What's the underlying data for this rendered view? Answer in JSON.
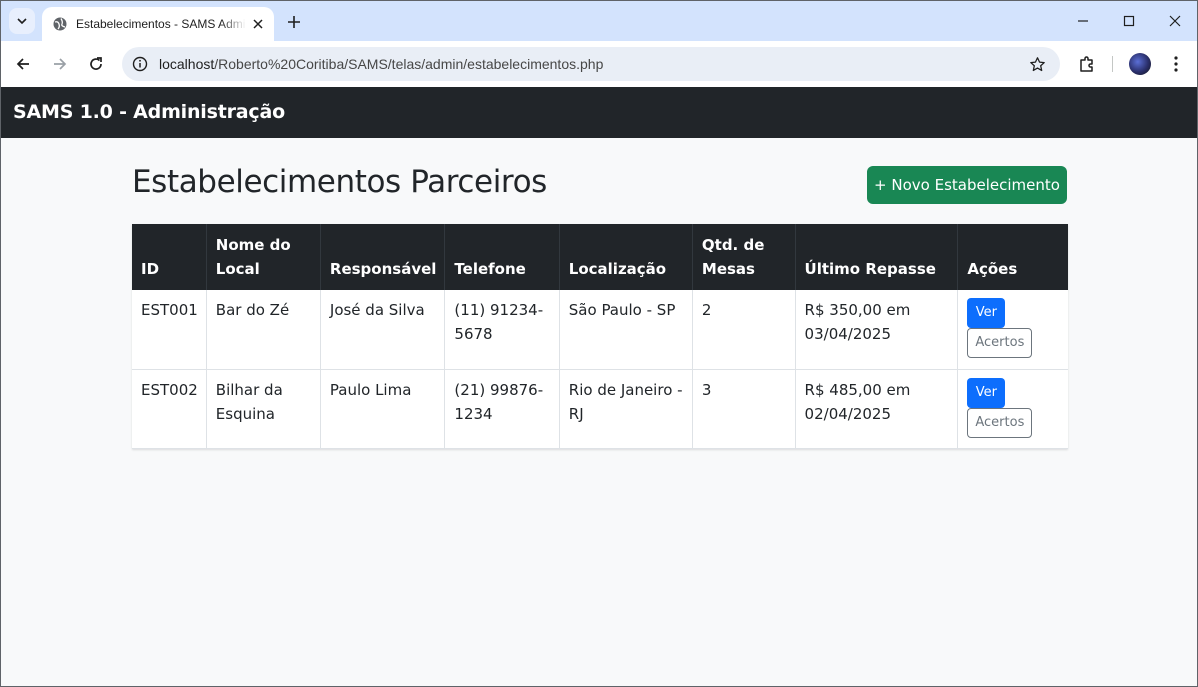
{
  "browser": {
    "tab_title": "Estabelecimentos - SAMS Admin",
    "url_host": "localhost",
    "url_path": "/Roberto%20Coritiba/SAMS/telas/admin/estabelecimentos.php"
  },
  "navbar": {
    "brand": "SAMS 1.0 - Administração"
  },
  "page": {
    "title": "Estabelecimentos Parceiros",
    "new_button": "+ Novo Estabelecimento"
  },
  "table": {
    "headers": [
      "ID",
      "Nome do Local",
      "Responsável",
      "Telefone",
      "Localização",
      "Qtd. de Mesas",
      "Último Repasse",
      "Ações"
    ],
    "rows": [
      {
        "id": "EST001",
        "nome": "Bar do Zé",
        "responsavel": "José da Silva",
        "telefone": "(11) 91234-5678",
        "localizacao": "São Paulo - SP",
        "mesas": "2",
        "repasse": "R$ 350,00 em 03/04/2025",
        "ver": "Ver",
        "acertos": "Acertos"
      },
      {
        "id": "EST002",
        "nome": "Bilhar da Esquina",
        "responsavel": "Paulo Lima",
        "telefone": "(21) 99876-1234",
        "localizacao": "Rio de Janeiro - RJ",
        "mesas": "3",
        "repasse": "R$ 485,00 em 02/04/2025",
        "ver": "Ver",
        "acertos": "Acertos"
      }
    ]
  },
  "colors": {
    "navbar_bg": "#212529",
    "success": "#198754",
    "primary": "#0d6efd",
    "secondary": "#6c757d"
  },
  "icons": {
    "tab_search": "chevron-down-icon",
    "favicon": "globe-icon",
    "tab_close": "close-icon",
    "new_tab": "plus-icon",
    "back": "arrow-left-icon",
    "forward": "arrow-right-icon",
    "reload": "reload-icon",
    "site_info": "info-icon",
    "bookmark": "star-icon",
    "extensions": "puzzle-icon",
    "menu": "kebab-menu-icon"
  }
}
